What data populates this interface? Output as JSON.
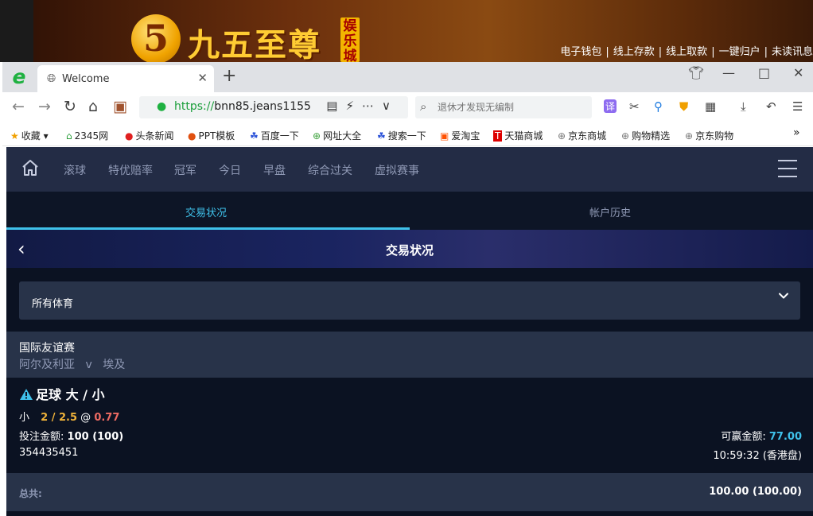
{
  "banner": {
    "logo_char": "5",
    "logo_text": "九五至尊",
    "logo_tag": "娱乐城",
    "links": [
      "电子钱包",
      "线上存款",
      "线上取款",
      "一键归户",
      "未读讯息"
    ]
  },
  "browser": {
    "tab_title": "Welcome",
    "url_protocol": "https://",
    "url_rest": "bnn85.jeans1155",
    "search_placeholder": "退休才发现无编制",
    "bookmarks": [
      "收藏",
      "2345网",
      "头条新闻",
      "PPT模板",
      "百度一下",
      "网址大全",
      "搜索一下",
      "爱淘宝",
      "天猫商城",
      "京东商城",
      "购物精选",
      "京东购物"
    ]
  },
  "site": {
    "nav": [
      "滚球",
      "特优赔率",
      "冠军",
      "今日",
      "早盘",
      "综合过关",
      "虚拟赛事"
    ],
    "subtabs": {
      "active": "交易状况",
      "inactive": "帐户历史"
    },
    "page_title": "交易状况",
    "filter_label": "所有体育",
    "league": "国际友谊赛",
    "match": {
      "home": "阿尔及利亚",
      "vs": "v",
      "away": "埃及"
    },
    "bet": {
      "title": "足球 大 / 小",
      "selection": "小",
      "line": "2 / 2.5",
      "at": "@",
      "odds": "0.77",
      "stake_label": "投注金额:",
      "stake_value": "100 (100)",
      "win_label": "可赢金额:",
      "win_value": "77.00",
      "ticket_id": "354435451",
      "time": "10:59:32 (香港盘)"
    },
    "total": {
      "label": "总共:",
      "value": "100.00 (100.00)"
    }
  },
  "colors": {
    "accent": "#3fc1ea",
    "odds": "#ef6b63",
    "line": "#f0b33a",
    "panel": "#283349",
    "bg": "#0b1222"
  }
}
